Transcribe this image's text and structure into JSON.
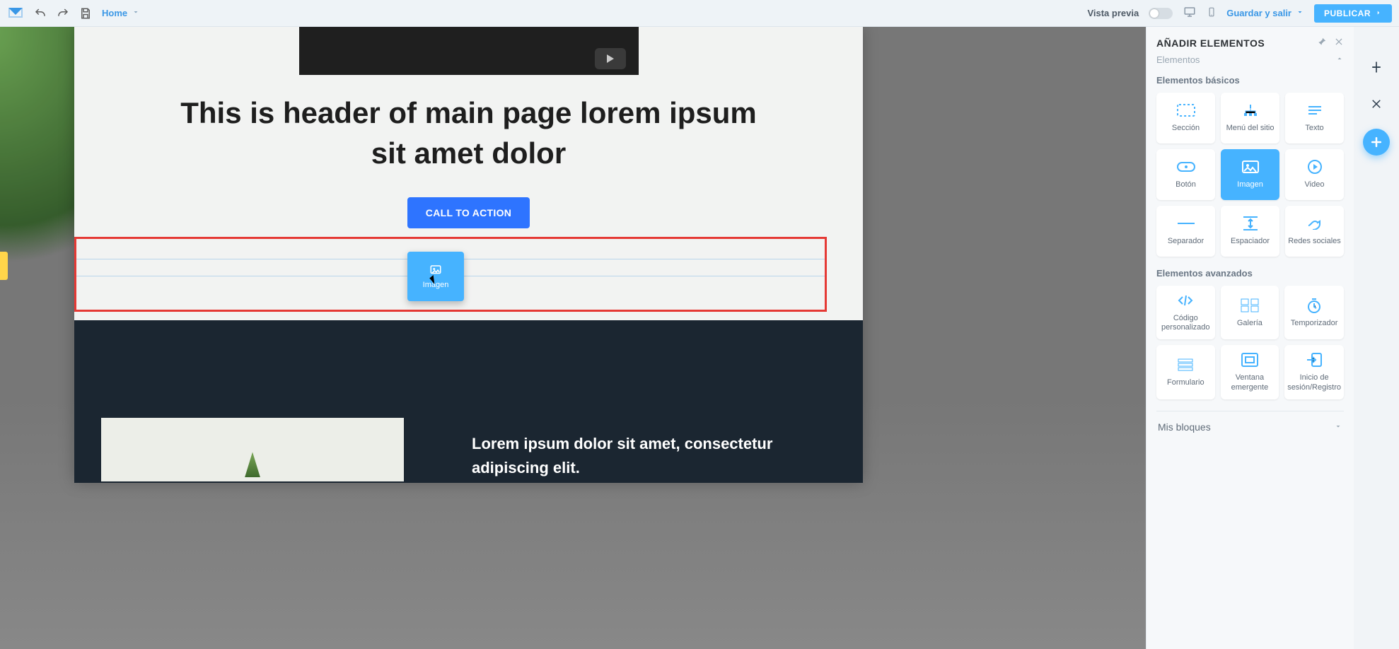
{
  "topbar": {
    "home": "Home",
    "preview": "Vista previa",
    "save_exit": "Guardar y salir",
    "publish": "PUBLICAR"
  },
  "page": {
    "headline": "This is header of main page lorem ipsum sit amet dolor",
    "cta": "CALL TO ACTION",
    "section_copy": "Lorem ipsum dolor sit amet, consectetur adipiscing elit."
  },
  "drag": {
    "chip_label": "Imagen"
  },
  "panel": {
    "title": "AÑADIR ELEMENTOS",
    "elements_label": "Elementos",
    "basic_title": "Elementos básicos",
    "advanced_title": "Elementos avanzados",
    "my_blocks": "Mis bloques",
    "basic": [
      {
        "k": "seccion",
        "label": "Sección"
      },
      {
        "k": "menu",
        "label": "Menú del sitio"
      },
      {
        "k": "texto",
        "label": "Texto"
      },
      {
        "k": "boton",
        "label": "Botón"
      },
      {
        "k": "imagen",
        "label": "Imagen"
      },
      {
        "k": "video",
        "label": "Video"
      },
      {
        "k": "separador",
        "label": "Separador"
      },
      {
        "k": "espaciador",
        "label": "Espaciador"
      },
      {
        "k": "redes",
        "label": "Redes sociales"
      }
    ],
    "advanced": [
      {
        "k": "codigo",
        "label": "Código personalizado"
      },
      {
        "k": "galeria",
        "label": "Galería"
      },
      {
        "k": "temporizador",
        "label": "Temporizador"
      },
      {
        "k": "formulario",
        "label": "Formulario"
      },
      {
        "k": "popup",
        "label": "Ventana emergente"
      },
      {
        "k": "login",
        "label": "Inicio de sesión/Registro"
      }
    ]
  }
}
